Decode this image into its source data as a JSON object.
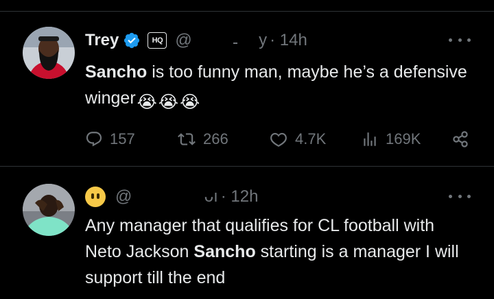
{
  "tweets": [
    {
      "author_name": "Trey",
      "handle_fragment": "@",
      "handle_tail": "y",
      "badge": "HQ",
      "time": "· 14h",
      "text_bold": "Sancho",
      "text_rest": " is too funny man, maybe he’s a defensive winger",
      "emojis": [
        "😭",
        "😭",
        "😭"
      ],
      "actions": {
        "replies": "157",
        "reposts": "266",
        "likes": "4.7K",
        "views": "169K"
      }
    },
    {
      "author_emoji": "😶",
      "handle_fragment": "@",
      "handle_tail": "ᴗı",
      "time": "· 12h",
      "text_pre": "Any manager that qualifies for CL football with Neto Jackson ",
      "text_bold": "Sancho",
      "text_post": " starting is a manager I will support till the end"
    }
  ],
  "colors": {
    "background": "#000000",
    "text": "#e7e9ea",
    "muted": "#71767b",
    "verified": "#1d9bf0",
    "divider": "#2f3336"
  },
  "icons": [
    "verified-badge-icon",
    "more-icon",
    "reply-icon",
    "repost-icon",
    "like-icon",
    "views-icon",
    "share-icon"
  ]
}
